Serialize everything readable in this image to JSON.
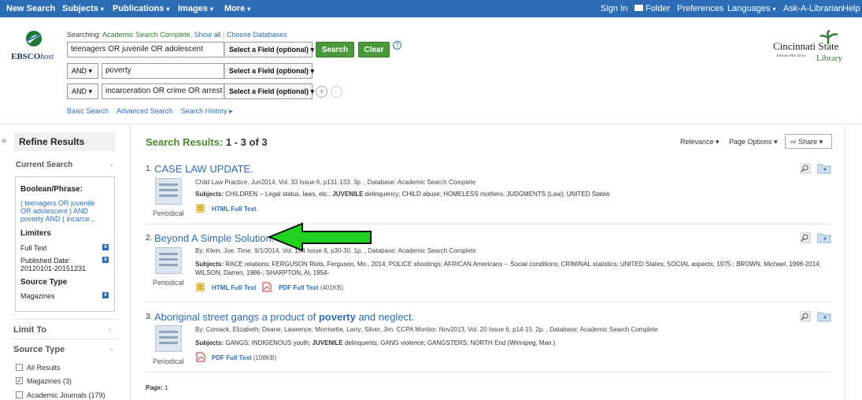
{
  "topbar": {
    "left": [
      "New Search",
      "Subjects",
      "Publications",
      "Images",
      "More"
    ],
    "right": [
      "Sign In",
      "Folder",
      "Preferences",
      "Languages",
      "Ask-A-Librarian",
      "Help"
    ]
  },
  "logo": {
    "text_bold": "EBSCO",
    "text_italic": "host"
  },
  "search": {
    "searching_label": "Searching:",
    "database": "Academic Search Complete,",
    "show_all": "Show all",
    "choose_databases": "Choose Databases",
    "rows": [
      {
        "bool": "",
        "value": "teenagers OR juvenile OR adolescent",
        "field": "Select a Field (optional)"
      },
      {
        "bool": "AND",
        "value": "poverty",
        "field": "Select a Field (optional)"
      },
      {
        "bool": "AND",
        "value": "incarceration OR crime OR arrest",
        "field": "Select a Field (optional)"
      }
    ],
    "search_button": "Search",
    "clear_button": "Clear",
    "help": "?",
    "links": [
      "Basic Search",
      "Advanced Search",
      "Search History ▸"
    ]
  },
  "library_logo": {
    "line1": "Cincinnati State",
    "line2": "Johnnie Mae Berry",
    "line3": "Library"
  },
  "refine": {
    "collapse": "«",
    "title": "Refine Results",
    "current_search": "Current Search",
    "boolean_heading": "Boolean/Phrase:",
    "boolean_query": "( teenagers OR juvenile OR adolescent ) AND poverty AND ( incarce...",
    "limiters_heading": "Limiters",
    "limiters": [
      "Full Text",
      "Published Date: 20120101-20151231"
    ],
    "source_type_heading": "Source Type",
    "source_types": [
      "Magazines"
    ],
    "limit_to": "Limit To",
    "source_type_section": "Source Type",
    "checkboxes": [
      {
        "label": "All Results",
        "checked": false
      },
      {
        "label": "Magazines (3)",
        "checked": true
      },
      {
        "label": "Academic Journals (179)",
        "checked": false
      }
    ]
  },
  "results": {
    "heading": "Search Results:",
    "range": "1 - 3 of 3",
    "relevance": "Relevance",
    "page_options": "Page Options",
    "share": "Share",
    "items": [
      {
        "num": "1.",
        "title": "CASE LAW UPDATE.",
        "meta": "Child Law Practice. Jun2014, Vol. 33 Issue 6, p131-133. 3p. , Database: Academic Search Complete",
        "subjects_label": "Subjects:",
        "subjects_html": "CHILDREN -- Legal status, laws, etc.; <b>JUVENILE</b> delinquency; CHILD abuse; HOMELESS mothers; JUDGMENTS (Law); UNITED States",
        "type": "Periodical",
        "html_full_text": "HTML Full Text"
      },
      {
        "num": "2.",
        "title": "Beyond A Simple Solution.",
        "meta": "By: Klein, Joe. Time. 9/1/2014, Vol. 184 Issue 8, p30-30. 1p. , Database: Academic Search Complete",
        "subjects_label": "Subjects:",
        "subjects_html": "RACE relations; FERGUSON Riots, Ferguson, Mo., 2014; POLICE shootings; AFRICAN Americans -- Social conditions; CRIMINAL statistics; UNITED States; SOCIAL aspects; 1975-; BROWN, Michael, 1996-2014; WILSON, Darren, 1986-; SHARPTON, Al, 1954-",
        "type": "Periodical",
        "html_full_text": "HTML Full Text",
        "pdf_full_text": "PDF Full Text",
        "pdf_size": "(401KB)"
      },
      {
        "num": "3.",
        "title_pre": "Aboriginal street gangs a product of ",
        "title_bold": "poverty",
        "title_post": " and neglect.",
        "meta": "By: Comack, Elizabeth; Deane, Lawrence; Morrisette, Larry; Silver, Jim. CCPA Monitor. Nov2013, Vol. 20 Issue 6, p14-15. 2p. , Database: Academic Search Complete",
        "subjects_label": "Subjects:",
        "subjects_html": "GANGS; INDIGENOUS youth; <b>JUVENILE</b> delinquents; GANG violence; GANGSTERS; NORTH End (Winnipeg, Man.)",
        "type": "Periodical",
        "pdf_full_text": "PDF Full Text",
        "pdf_size": "(108KB)"
      }
    ],
    "page_label": "Page:",
    "page_num": "1"
  },
  "colors": {
    "topbar": "#2d6db5",
    "button_green": "#4a9a3c",
    "link_blue": "#2d6db5",
    "heading_green": "#4a8a2e",
    "arrow_green": "#1fd21f"
  }
}
